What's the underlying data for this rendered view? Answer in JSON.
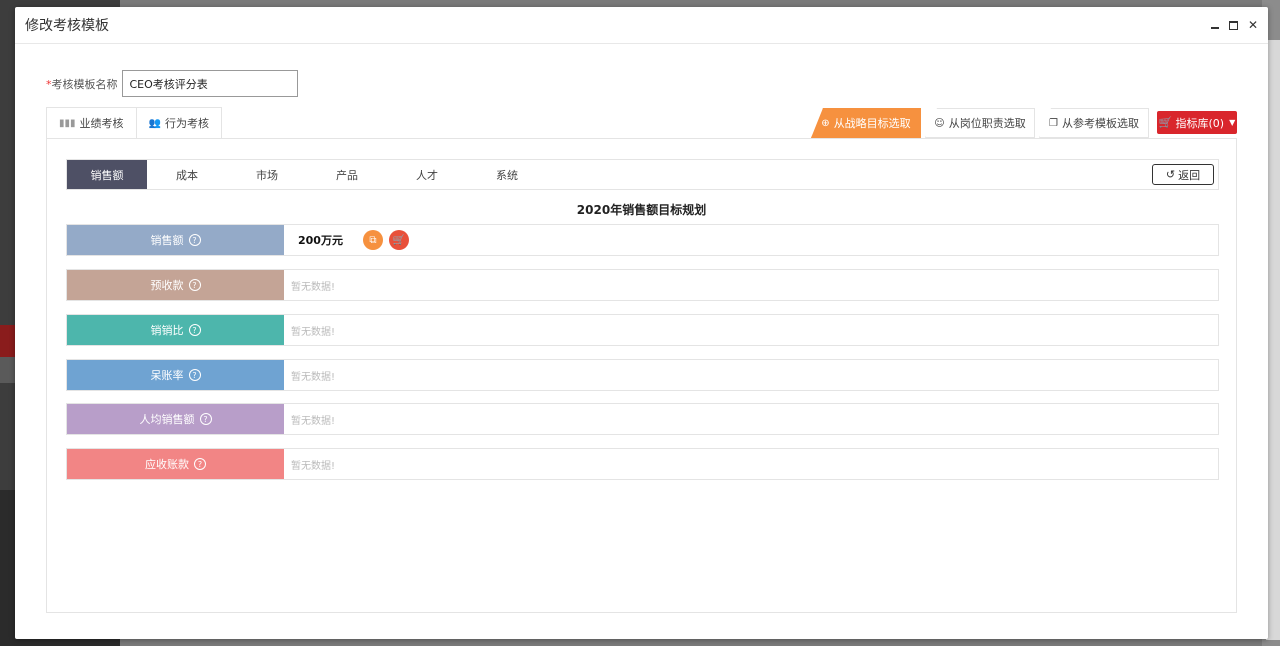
{
  "modal": {
    "title": "修改考核模板"
  },
  "form": {
    "name_label": "考核模板名称",
    "required_mark": "*",
    "name_value": "CEO考核评分表"
  },
  "type_tabs": [
    {
      "label": "业绩考核",
      "icon": "bar-chart-icon"
    },
    {
      "label": "行为考核",
      "icon": "users-icon"
    }
  ],
  "source_tabs": [
    {
      "label": "从战略目标选取",
      "icon": "crosshair-icon",
      "active": true
    },
    {
      "label": "从岗位职责选取",
      "icon": "user-icon",
      "active": false
    },
    {
      "label": "从参考模板选取",
      "icon": "copy-icon",
      "active": false
    }
  ],
  "library_button": {
    "label": "指标库(0)",
    "icon": "cart-icon",
    "color": "#d9262c"
  },
  "categories": [
    "销售额",
    "成本",
    "市场",
    "产品",
    "人才",
    "系统"
  ],
  "back_button": {
    "label": "返回",
    "icon": "undo-icon"
  },
  "plan_title": "2020年销售额目标规划",
  "metrics": [
    {
      "label": "销售额",
      "color": "#94aac8",
      "value": "200万元",
      "empty": ""
    },
    {
      "label": "预收款",
      "color": "#c4a496",
      "value": "",
      "empty": "暂无数据!"
    },
    {
      "label": "销销比",
      "color": "#4db6ac",
      "value": "",
      "empty": "暂无数据!"
    },
    {
      "label": "呆账率",
      "color": "#6fa3d2",
      "value": "",
      "empty": "暂无数据!"
    },
    {
      "label": "人均销售额",
      "color": "#b89ec9",
      "value": "",
      "empty": "暂无数据!"
    },
    {
      "label": "应收账款",
      "color": "#f28585",
      "value": "",
      "empty": "暂无数据!"
    }
  ],
  "colors": {
    "accent_orange": "#f6913f",
    "active_category": "#4e5065",
    "danger_red": "#e8503a"
  }
}
